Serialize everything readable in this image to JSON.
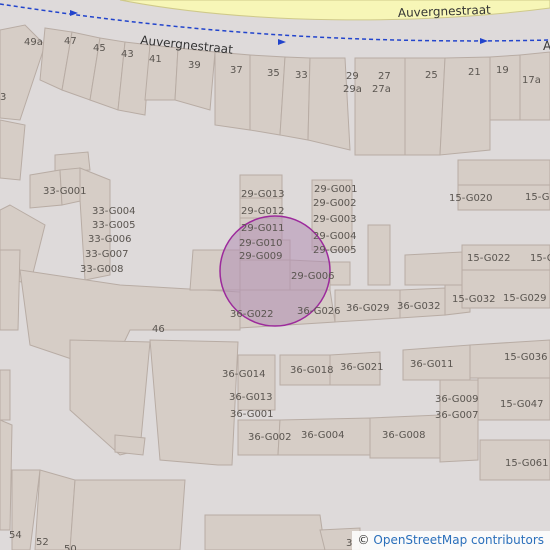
{
  "map": {
    "streets": [
      "Auvergnestraat",
      "Auvergnestraat"
    ],
    "street_partial": "A",
    "attribution": {
      "symbol": "©",
      "link_text": "OpenStreetMap contributors"
    },
    "marker": {
      "fill": "#b28fb4",
      "stroke": "#9c2a9c"
    },
    "colors": {
      "building": "#d6cdc6",
      "building_stroke": "#b8aca4",
      "road": "#f7f6b7",
      "road_edge": "#cfc98a",
      "route": "#2244cc",
      "ground": "#dedada"
    },
    "labels": [
      "49a",
      "47",
      "45",
      "43",
      "41",
      "39",
      "37",
      "35",
      "33",
      "29",
      "29a",
      "27",
      "27a",
      "25",
      "21",
      "19",
      "17a",
      "3",
      "33-G001",
      "33-G004",
      "33-G005",
      "33-G006",
      "33-G007",
      "33-G008",
      "29-G013",
      "29-G012",
      "29-G011",
      "29-G010",
      "29-G009",
      "29-G001",
      "29-G002",
      "29-G003",
      "29-G004",
      "29-G005",
      "29-G006",
      "15-G020",
      "15-G0",
      "15-G022",
      "15-G032",
      "15-G029",
      "15-G02",
      "46",
      "36-G022",
      "36-G026",
      "36-G029",
      "36-G032",
      "36-G014",
      "36-G018",
      "36-G021",
      "36-G011",
      "15-G036",
      "36-G013",
      "36-G001",
      "36-G009",
      "36-G007",
      "15-G047",
      "36-G002",
      "36-G004",
      "36-G008",
      "15-G061",
      "54",
      "52",
      "50",
      "3"
    ]
  }
}
